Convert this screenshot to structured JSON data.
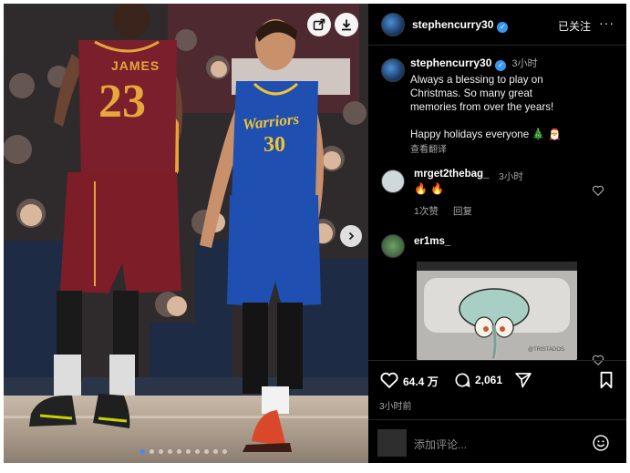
{
  "photo": {
    "jerseys": {
      "left": {
        "name": "JAMES",
        "number": "23"
      },
      "right": {
        "team": "Warriors",
        "number": "30"
      }
    },
    "icons": {
      "share": "share-icon",
      "download": "download-icon",
      "next": "chevron-right-icon"
    },
    "carousel": {
      "total": 10,
      "active_index": 0
    }
  },
  "header": {
    "username": "stephencurry30",
    "follow_label": "已关注",
    "more": "···"
  },
  "caption": {
    "username": "stephencurry30",
    "time": "3小时",
    "line1": "Always a blessing to play on",
    "line2": "Christmas. So many great",
    "line3": "memories from over the years!",
    "line4": "Happy holidays everyone 🎄 🎅",
    "translate": "查看翻译"
  },
  "comments": [
    {
      "username": "mrget2thebag_",
      "time": "3小时",
      "text": "🔥 🔥",
      "likes": "1次赞",
      "reply": "回复"
    },
    {
      "username": "er1ms_"
    }
  ],
  "meme": {
    "watermark": "@TRISTADOS"
  },
  "actions": {
    "likes": "64.4 万",
    "comments": "2,061"
  },
  "posted_time": "3小时前",
  "comment_box": {
    "placeholder": "添加评论..."
  },
  "colors": {
    "panel_bg": "#000000",
    "verified": "#3897f0",
    "warriors_blue": "#1f4fb0",
    "cavs_wine": "#7a1f2b"
  }
}
